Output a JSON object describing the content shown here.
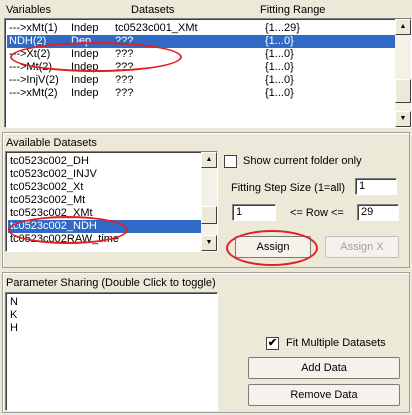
{
  "headers": {
    "variables": "Variables",
    "datasets": "Datasets",
    "fitting_range": "Fitting Range"
  },
  "variables_rows": [
    {
      "name": "--->xMt(1)",
      "type": "Indep",
      "dataset": "tc0523c001_XMt",
      "range": "{1...29}"
    },
    {
      "name": "NDH(2)",
      "type": "Dep",
      "dataset": "???",
      "range": "{1...0}"
    },
    {
      "name": "--->Xt(2)",
      "type": "Indep",
      "dataset": "???",
      "range": "{1...0}"
    },
    {
      "name": "--->Mt(2)",
      "type": "Indep",
      "dataset": "???",
      "range": "{1...0}"
    },
    {
      "name": "--->InjV(2)",
      "type": "Indep",
      "dataset": "???",
      "range": "{1...0}"
    },
    {
      "name": "--->xMt(2)",
      "type": "Indep",
      "dataset": "???",
      "range": "{1...0}"
    }
  ],
  "available_datasets": {
    "label": "Available Datasets",
    "items": [
      "tc0523c002_DH",
      "tc0523c002_INJV",
      "tc0523c002_Xt",
      "tc0523c002_Mt",
      "tc0523c002_XMt",
      "tc0523c002_NDH",
      "tc0523c002RAW_time"
    ],
    "selected_index": 5
  },
  "controls": {
    "show_current_folder_only": "Show current folder only",
    "show_current_folder_checked": false,
    "fitting_step_label": "Fitting Step Size (1=all)",
    "fitting_step_value": "1",
    "row_from": "1",
    "row_label": "<= Row <=",
    "row_to": "29",
    "assign": "Assign",
    "assign_x": "Assign X"
  },
  "parameter_sharing": {
    "label": "Parameter Sharing (Double Click to toggle)",
    "items": [
      "N",
      "K",
      "H"
    ]
  },
  "bottom": {
    "fit_multiple": "Fit Multiple Datasets",
    "fit_multiple_checked": true,
    "add_data": "Add Data",
    "remove_data": "Remove Data"
  },
  "colors": {
    "selection": "#316ac5",
    "annotation": "#e02020",
    "panel_bg": "#ece9d8"
  },
  "icons": {
    "scroll_up": "▲",
    "scroll_down": "▼",
    "check": "✔"
  }
}
